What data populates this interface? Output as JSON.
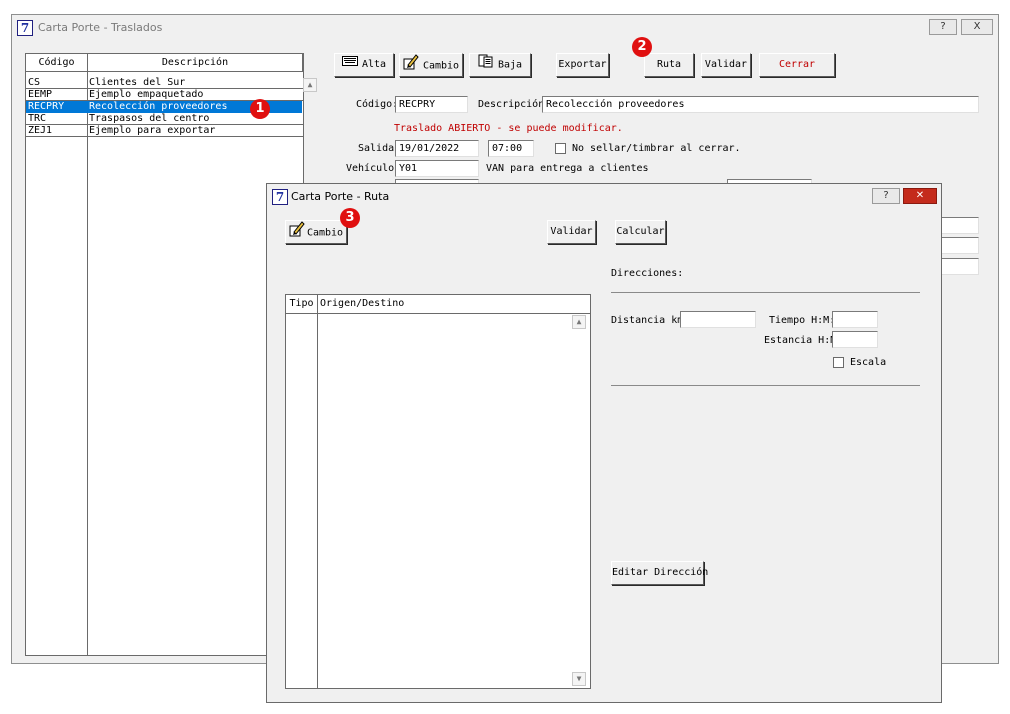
{
  "main_window": {
    "title": "Carta Porte - Traslados",
    "help_label": "?",
    "close_label": "X",
    "grid": {
      "headers": [
        "Código",
        "Descripción"
      ],
      "rows": [
        {
          "code": "CS",
          "desc": "Clientes del Sur"
        },
        {
          "code": "EEMP",
          "desc": "Ejemplo empaquetado"
        },
        {
          "code": "RECPRY",
          "desc": "Recolección proveedores"
        },
        {
          "code": "TRC",
          "desc": "Traspasos del centro"
        },
        {
          "code": "ZEJ1",
          "desc": "Ejemplo para exportar"
        }
      ]
    },
    "toolbar": {
      "alta": "Alta",
      "cambio": "Cambio",
      "baja": "Baja",
      "exportar": "Exportar",
      "ruta": "Ruta",
      "validar": "Validar",
      "cerrar": "Cerrar"
    },
    "form": {
      "codigo_label": "Código:",
      "codigo_value": "RECPRY",
      "descripcion_label": "Descripción:",
      "descripcion_value": "Recolección proveedores",
      "status_text": "Traslado ABIERTO - se puede modificar.",
      "salida_label": "Salida:",
      "salida_date": "19/01/2022",
      "salida_time": "07:00",
      "no_sellar_label": "No sellar/timbrar al cerrar.",
      "vehiculo_label": "Vehículo:",
      "vehiculo_value": "Y01",
      "vehiculo_desc": "VAN para entrega a clientes"
    }
  },
  "dialog": {
    "title": "Carta Porte - Ruta",
    "help_label": "?",
    "close_label": "✕",
    "cambio": "Cambio",
    "validar": "Validar",
    "calcular": "Calcular",
    "grid_headers": [
      "Tipo",
      "Origen/Destino"
    ],
    "direcciones_label": "Direcciones:",
    "distancia_label": "Distancia km:",
    "tiempo_label": "Tiempo H:M:",
    "estancia_label": "Estancia H:M:",
    "escala_label": "Escala",
    "editar_direccion": "Editar Dirección"
  },
  "badges": [
    "1",
    "2",
    "3"
  ],
  "colors": {
    "selection": "#0078d7",
    "badge": "#e01010",
    "cerrar_text": "#c00000",
    "status_text": "#c00000",
    "dialog_close": "#c42b1c"
  }
}
